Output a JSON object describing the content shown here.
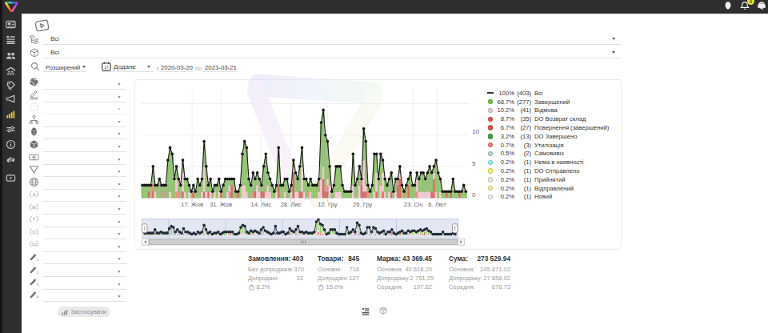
{
  "topbar": {
    "notification_badge": "0",
    "icons": [
      "user-icon",
      "bell-icon",
      "support-headset-icon"
    ]
  },
  "rail": {
    "items": [
      {
        "icon": "dashboard-card-icon"
      },
      {
        "icon": "order-list-icon"
      },
      {
        "icon": "clients-icon"
      },
      {
        "icon": "warehouse-icon"
      },
      {
        "icon": "price-tag-icon"
      },
      {
        "icon": "marketing-megaphone-icon"
      },
      {
        "icon": "statistics-bars-icon",
        "active": true
      },
      {
        "icon": "settings-sliders-icon"
      },
      {
        "icon": "info-icon"
      },
      {
        "icon": "partners-hands-icon"
      },
      {
        "icon": "video-tutorial-icon"
      }
    ],
    "active_color": "#e0c63e"
  },
  "filters": {
    "video_hint_icon": "video-play-icon",
    "status_filter": {
      "icon": "flow-tree-icon",
      "value": "Всі"
    },
    "product_filter": {
      "icon": "package-cube-icon",
      "value": "Всі"
    },
    "search_mode": {
      "icon": "search-icon",
      "value": "Розширений"
    },
    "date_field": {
      "icon": "calendar-icon",
      "value": "Додане"
    },
    "date_from_label": "з",
    "date_from": "2020-03-20",
    "date_to_label": "по",
    "date_to": "2023-03-21"
  },
  "sidebar_filters": {
    "rows": [
      {
        "icon": "globe-icon"
      },
      {
        "icon": "pen-signature-icon"
      },
      {
        "icon": "question-circle-icon",
        "disabled": true
      },
      {
        "icon": "org-tree-icon"
      },
      {
        "icon": "person-icon"
      },
      {
        "icon": "cube-icon"
      },
      {
        "icon": "banknote-eye-icon"
      },
      {
        "icon": "funnel-icon"
      },
      {
        "icon": "globe-grid-icon"
      },
      {
        "icon": "utm-source-icon",
        "tag": "S"
      },
      {
        "icon": "utm-medium-icon",
        "tag": "M"
      },
      {
        "icon": "utm-term-icon",
        "tag": "T"
      },
      {
        "icon": "utm-content-icon",
        "tag": "Ct"
      },
      {
        "icon": "utm-campaign-icon",
        "tag": "Cp"
      },
      {
        "icon": "pencil-icon",
        "num": "1"
      },
      {
        "icon": "pencil-icon",
        "num": "2"
      },
      {
        "icon": "pencil-icon",
        "num": "3"
      },
      {
        "icon": "pencil-icon",
        "num": "4"
      }
    ]
  },
  "apply_button": {
    "label": "Застосувати",
    "icon": "mini-bars-icon"
  },
  "chart_data": {
    "type": "line+stacked-bar",
    "title": "",
    "xlabel": "",
    "ylabel": "",
    "yticks": [
      0,
      5,
      10
    ],
    "ylim": [
      0,
      15.5
    ],
    "grid": true,
    "xticks": [
      {
        "label": "17. Жов",
        "f": 0.1543
      },
      {
        "label": "31. Жов",
        "f": 0.2421
      },
      {
        "label": "14. Лис",
        "f": 0.365
      },
      {
        "label": "28. Лис",
        "f": 0.456
      },
      {
        "label": "12. Гру",
        "f": 0.5682
      },
      {
        "label": "26. Гру",
        "f": 0.6753
      },
      {
        "label": "23. Січ",
        "f": 0.8303
      },
      {
        "label": "6. Лют",
        "f": 0.9032
      }
    ],
    "days": {
      "totals": [
        2,
        2,
        2,
        2,
        2,
        5,
        2,
        2,
        3,
        2,
        2,
        2,
        6,
        8,
        7,
        3,
        5,
        3,
        2,
        6,
        3,
        3,
        2,
        1,
        2,
        1,
        3,
        2,
        3,
        9,
        5,
        2,
        3,
        1,
        2,
        2,
        3,
        1,
        2,
        3,
        3,
        3,
        3,
        3,
        1,
        1,
        2,
        7,
        9,
        8,
        3,
        2,
        4,
        3,
        4,
        3,
        2,
        5,
        7,
        4,
        3,
        2,
        1,
        2,
        8,
        2,
        2,
        3,
        3,
        1,
        2,
        6,
        4,
        3,
        5,
        8,
        3,
        3,
        2,
        3,
        2,
        2,
        2,
        3,
        12,
        14,
        10,
        9,
        5,
        1,
        2,
        5,
        5,
        5,
        2,
        1,
        1,
        1,
        1,
        7,
        2,
        3,
        5,
        3,
        11,
        9,
        2,
        1,
        2,
        7,
        7,
        3,
        7,
        6,
        3,
        2,
        3,
        4,
        1,
        3,
        3,
        5,
        2,
        1,
        2,
        3,
        4,
        2,
        2,
        4,
        3,
        4,
        4,
        3,
        4,
        5,
        4,
        5,
        6,
        4,
        3,
        1,
        1,
        1,
        1,
        1,
        3,
        1,
        1,
        1,
        1,
        2,
        1
      ],
      "green": [
        2,
        2,
        2,
        1,
        2,
        3,
        1,
        2,
        3,
        2,
        1,
        2,
        6,
        7,
        7,
        3,
        2,
        2,
        2,
        2,
        2,
        3,
        1,
        1,
        1,
        1,
        3,
        2,
        2,
        4,
        4,
        1,
        2,
        1,
        1,
        2,
        2,
        0,
        2,
        3,
        2,
        1,
        1,
        3,
        1,
        0,
        2,
        5,
        7,
        7,
        3,
        2,
        3,
        2,
        2,
        2,
        1,
        4,
        6,
        2,
        2,
        2,
        1,
        1,
        6,
        2,
        2,
        2,
        3,
        1,
        1,
        1,
        3,
        2,
        4,
        3,
        2,
        3,
        1,
        2,
        2,
        2,
        2,
        2,
        9,
        9,
        8,
        6,
        3,
        1,
        2,
        4,
        4,
        4,
        2,
        1,
        1,
        1,
        1,
        5,
        2,
        3,
        3,
        0,
        5,
        7,
        1,
        1,
        2,
        6,
        3,
        3,
        5,
        2,
        2,
        2,
        2,
        3,
        1,
        2,
        0,
        1,
        2,
        0,
        2,
        1,
        4,
        2,
        2,
        1,
        2,
        3,
        3,
        2,
        3,
        4,
        3,
        1,
        5,
        4,
        2,
        1,
        1,
        0,
        1,
        0,
        3,
        1,
        1,
        0,
        1,
        2,
        1
      ],
      "pink": [
        0,
        0,
        0,
        0,
        0,
        0,
        1,
        0,
        0,
        0,
        0,
        0,
        0,
        1,
        0,
        0,
        2,
        0,
        0,
        3,
        1,
        0,
        1,
        0,
        0,
        0,
        0,
        0,
        1,
        4,
        1,
        0,
        1,
        0,
        1,
        0,
        1,
        0,
        0,
        0,
        1,
        1,
        0,
        0,
        0,
        0,
        0,
        2,
        2,
        1,
        0,
        0,
        0,
        0,
        2,
        1,
        0,
        0,
        1,
        2,
        1,
        0,
        0,
        1,
        0,
        0,
        0,
        1,
        0,
        0,
        1,
        1,
        1,
        1,
        0,
        4,
        1,
        0,
        0,
        1,
        0,
        0,
        0,
        1,
        3,
        2,
        0,
        1,
        2,
        0,
        0,
        1,
        1,
        1,
        0,
        0,
        0,
        0,
        0,
        2,
        0,
        0,
        2,
        0,
        5,
        1,
        0,
        0,
        0,
        1,
        3,
        0,
        2,
        3,
        1,
        0,
        1,
        0,
        0,
        1,
        0,
        1,
        0,
        0,
        0,
        0,
        0,
        0,
        0,
        2,
        1,
        1,
        1,
        1,
        1,
        1,
        0,
        1,
        1,
        0,
        1,
        0,
        0,
        0,
        0,
        0,
        0,
        0,
        0,
        0,
        0,
        0,
        0
      ],
      "red": [
        0,
        0,
        0,
        1,
        0,
        1,
        0,
        0,
        0,
        0,
        0,
        0,
        0,
        0,
        0,
        0,
        0,
        0,
        0,
        1,
        0,
        0,
        0,
        0,
        1,
        0,
        0,
        0,
        0,
        1,
        0,
        1,
        0,
        0,
        0,
        0,
        0,
        1,
        0,
        0,
        0,
        0,
        2,
        0,
        0,
        1,
        0,
        0,
        0,
        0,
        0,
        0,
        0,
        1,
        0,
        0,
        1,
        1,
        0,
        0,
        0,
        0,
        0,
        0,
        2,
        0,
        0,
        0,
        0,
        0,
        0,
        4,
        0,
        0,
        1,
        1,
        0,
        0,
        0,
        0,
        0,
        0,
        0,
        0,
        0,
        3,
        1,
        1,
        0,
        0,
        0,
        0,
        0,
        0,
        0,
        0,
        0,
        0,
        0,
        0,
        0,
        0,
        0,
        2,
        1,
        1,
        0,
        0,
        0,
        0,
        1,
        0,
        0,
        1,
        0,
        0,
        0,
        1,
        0,
        0,
        2,
        3,
        0,
        0,
        0,
        2,
        0,
        0,
        0,
        0,
        0,
        0,
        0,
        0,
        0,
        0,
        1,
        3,
        0,
        0,
        0,
        0,
        0,
        1,
        0,
        1,
        0,
        0,
        0,
        1,
        0,
        0,
        0
      ],
      "salmon": [
        0,
        0,
        0,
        0,
        0,
        1,
        0,
        0,
        0,
        0,
        1,
        0,
        0,
        0,
        0,
        0,
        1,
        1,
        0,
        0,
        0,
        0,
        0,
        0,
        0,
        0,
        0,
        0,
        0,
        0,
        0,
        0,
        0,
        0,
        0,
        0,
        0,
        0,
        0,
        0,
        0,
        1,
        0,
        0,
        0,
        0,
        0,
        0,
        0,
        0,
        0,
        0,
        1,
        0,
        0,
        0,
        0,
        0,
        0,
        0,
        0,
        0,
        0,
        0,
        0,
        0,
        0,
        0,
        0,
        0,
        0,
        0,
        0,
        0,
        0,
        0,
        0,
        0,
        1,
        0,
        0,
        0,
        0,
        0,
        0,
        0,
        1,
        1,
        0,
        0,
        0,
        0,
        0,
        0,
        0,
        0,
        0,
        0,
        0,
        0,
        0,
        0,
        0,
        1,
        0,
        0,
        1,
        0,
        0,
        0,
        0,
        0,
        0,
        0,
        0,
        0,
        0,
        0,
        0,
        0,
        1,
        0,
        0,
        1,
        0,
        0,
        0,
        0,
        0,
        1,
        0,
        0,
        0,
        0,
        0,
        0,
        0,
        0,
        0,
        0,
        0,
        0,
        0,
        0,
        0,
        0,
        0,
        0,
        0,
        0,
        0,
        0,
        0
      ]
    },
    "colors": {
      "green": "#97c873",
      "pink": "#f2ccd3",
      "red": "#dc6a60",
      "salmon": "#ea9287",
      "line": "#1a1a1a",
      "nav_dot": "#232a38"
    },
    "navigator_gridlines_f": [
      0.0856,
      0.265,
      0.445,
      0.6247,
      0.8044
    ],
    "legend_position": "right",
    "legend": [
      {
        "swatch": "line",
        "color": "#333333",
        "pct": "100%",
        "count": "(403)",
        "label": "Всі"
      },
      {
        "swatch": "circle",
        "color": "#6fbf44",
        "pct": "68.7%",
        "count": "(277)",
        "label": "Завершений"
      },
      {
        "swatch": "circle",
        "color": "#f6c8cf",
        "pct": "10.2%",
        "count": "(41)",
        "label": "Відмова"
      },
      {
        "swatch": "circle",
        "color": "#e0534d",
        "pct": "8.7%",
        "count": "(35)",
        "label": "DO Возврат склад"
      },
      {
        "swatch": "circle",
        "color": "#e0534d",
        "pct": "6.7%",
        "count": "(27)",
        "label": "Повернення (завершений)"
      },
      {
        "swatch": "circle",
        "color": "#4aa53c",
        "pct": "3.2%",
        "count": "(13)",
        "label": "DO Завершено"
      },
      {
        "swatch": "circle",
        "color": "#ea8072",
        "pct": "0.7%",
        "count": "(3)",
        "label": "Утилізація"
      },
      {
        "swatch": "circle",
        "color": "#b6d9cf",
        "pct": "0.5%",
        "count": "(2)",
        "label": "Самовивіз"
      },
      {
        "swatch": "circle",
        "color": "#8af2f9",
        "pct": "0.2%",
        "count": "(1)",
        "label": "Нема в наявності"
      },
      {
        "swatch": "circle",
        "color": "#fbf559",
        "pct": "0.2%",
        "count": "(1)",
        "label": "DO Отправлено"
      },
      {
        "swatch": "circle",
        "color": "#e8eedd",
        "pct": "0.2%",
        "count": "(1)",
        "label": "Прийнятий"
      },
      {
        "swatch": "circle",
        "color": "#f6eb92",
        "pct": "0.2%",
        "count": "(1)",
        "label": "Відправлений"
      },
      {
        "swatch": "circle",
        "color": "#ededed",
        "pct": "0.2%",
        "count": "(1)",
        "label": "Новий"
      }
    ]
  },
  "stats": {
    "columns": [
      {
        "title": "Замовлення:",
        "value": "403",
        "rows": [
          {
            "l": "Без допродажів:",
            "v": "370"
          },
          {
            "l": "Допродані:",
            "v": "33"
          },
          {
            "icon": "shopping-bag-icon",
            "v": "8.2%"
          }
        ]
      },
      {
        "title": "Товари:",
        "value": "845",
        "rows": [
          {
            "l": "Основні:",
            "v": "718"
          },
          {
            "l": "Допродані:",
            "v": "127"
          },
          {
            "icon": "shopping-bag-icon",
            "v": "15.0%"
          }
        ]
      },
      {
        "title": "Маржа:",
        "value": "43 369.45",
        "rows": [
          {
            "l": "Основна:",
            "v": "40 618.20"
          },
          {
            "l": "Допродажу:",
            "v": "2 751.25"
          },
          {
            "l": "Середня:",
            "v": "107.62"
          }
        ]
      },
      {
        "title": "Сума:",
        "value": "273 529.94",
        "rows": [
          {
            "l": "Основна:",
            "v": "245 871.02"
          },
          {
            "l": "Допродажу:",
            "v": "27 658.92"
          },
          {
            "l": "Середня:",
            "v": "678.73"
          }
        ]
      }
    ]
  },
  "footer": {
    "view_toggles": [
      {
        "icon": "list-view-icon"
      },
      {
        "icon": "package-view-icon"
      }
    ]
  }
}
